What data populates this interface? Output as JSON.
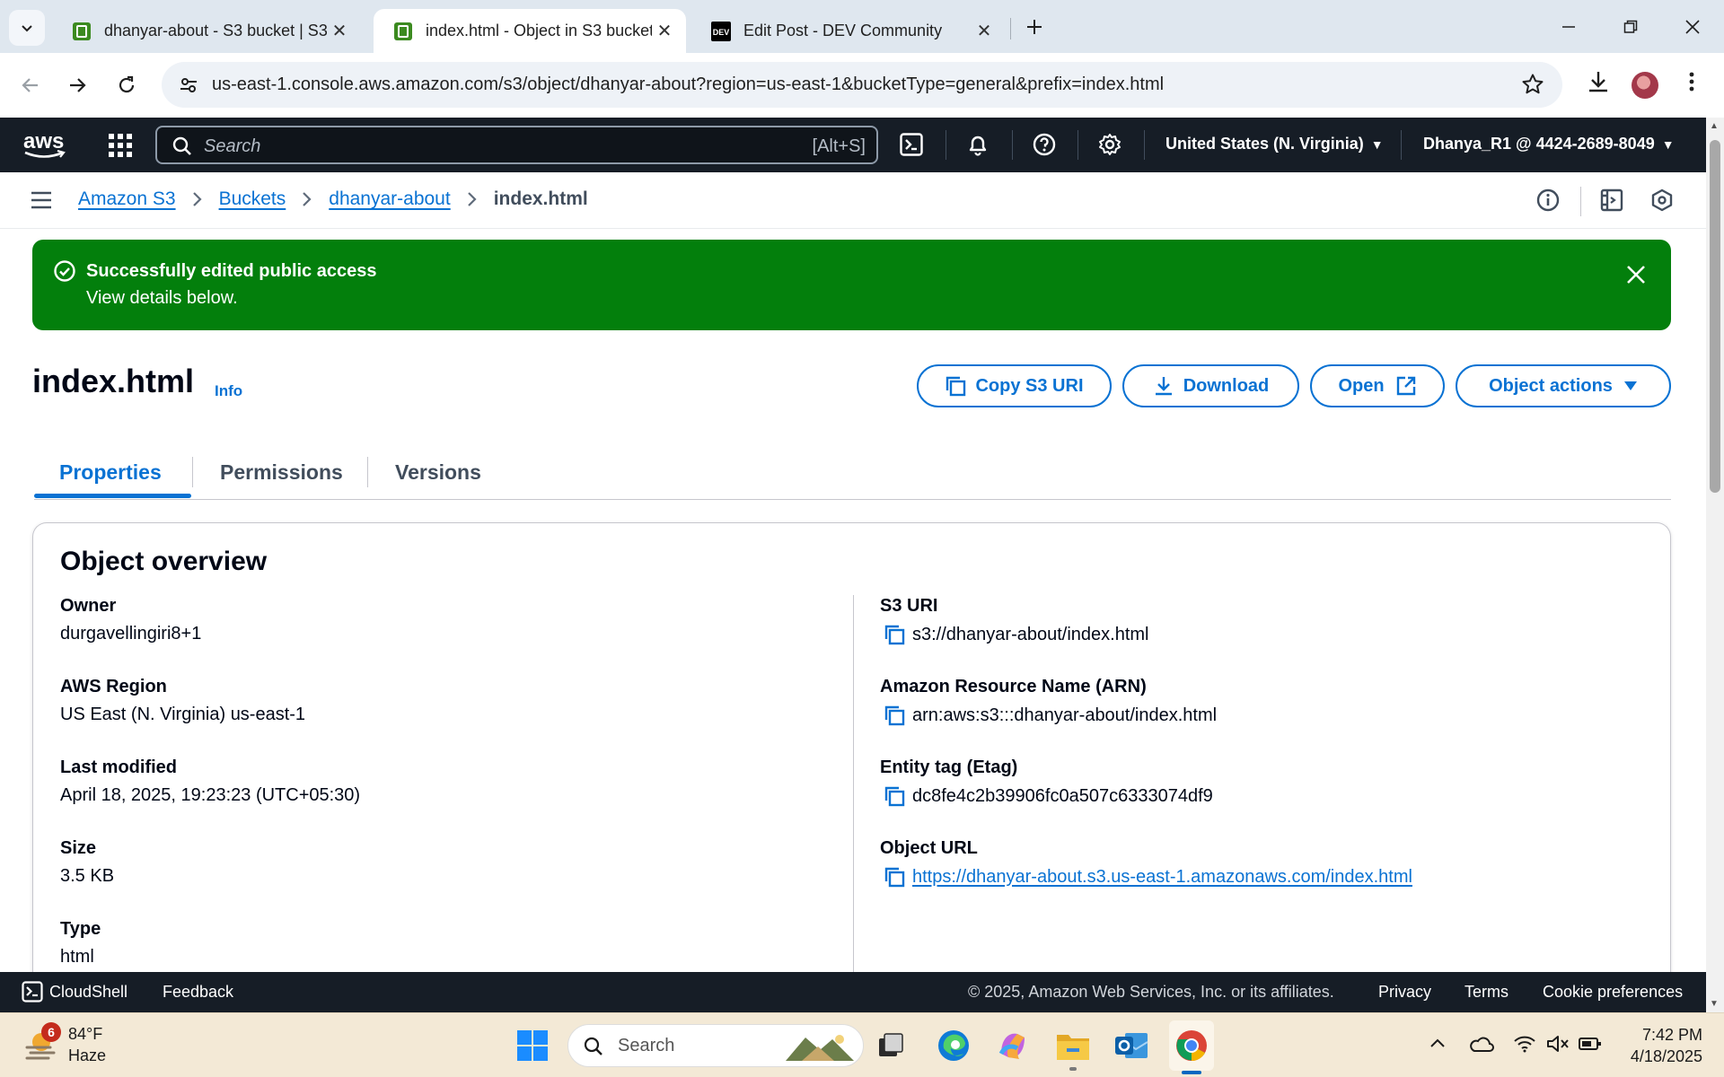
{
  "browser": {
    "tabs": [
      {
        "title": "dhanyar-about - S3 bucket | S3",
        "active": false
      },
      {
        "title": "index.html - Object in S3 bucket",
        "active": true
      },
      {
        "title": "Edit Post - DEV Community",
        "active": false
      }
    ],
    "url": "us-east-1.console.aws.amazon.com/s3/object/dhanyar-about?region=us-east-1&bucketType=general&prefix=index.html"
  },
  "aws_nav": {
    "search_placeholder": "Search",
    "search_shortcut": "[Alt+S]",
    "region": "United States (N. Virginia)",
    "account": "Dhanya_R1 @ 4424-2689-8049"
  },
  "breadcrumb": {
    "items": [
      "Amazon S3",
      "Buckets",
      "dhanyar-about"
    ],
    "current": "index.html"
  },
  "flash": {
    "title": "Successfully edited public access",
    "message": "View details below."
  },
  "header": {
    "title": "index.html",
    "info": "Info",
    "buttons": {
      "copy_uri": "Copy S3 URI",
      "download": "Download",
      "open": "Open",
      "object_actions": "Object actions"
    }
  },
  "content_tabs": [
    "Properties",
    "Permissions",
    "Versions"
  ],
  "overview": {
    "heading": "Object overview",
    "left": [
      {
        "label": "Owner",
        "value": "durgavellingiri8+1"
      },
      {
        "label": "AWS Region",
        "value": "US East (N. Virginia) us-east-1"
      },
      {
        "label": "Last modified",
        "value": "April 18, 2025, 19:23:23 (UTC+05:30)"
      },
      {
        "label": "Size",
        "value": "3.5 KB"
      },
      {
        "label": "Type",
        "value": "html"
      }
    ],
    "right": [
      {
        "label": "S3 URI",
        "value": "s3://dhanyar-about/index.html"
      },
      {
        "label": "Amazon Resource Name (ARN)",
        "value": "arn:aws:s3:::dhanyar-about/index.html"
      },
      {
        "label": "Entity tag (Etag)",
        "value": "dc8fe4c2b39906fc0a507c6333074df9"
      },
      {
        "label": "Object URL",
        "value": "https://dhanyar-about.s3.us-east-1.amazonaws.com/index.html"
      }
    ]
  },
  "footer": {
    "cloudshell": "CloudShell",
    "feedback": "Feedback",
    "copyright": "© 2025, Amazon Web Services, Inc. or its affiliates.",
    "privacy": "Privacy",
    "terms": "Terms",
    "cookies": "Cookie preferences"
  },
  "taskbar": {
    "weather_temp": "84°F",
    "weather_desc": "Haze",
    "weather_badge": "6",
    "search": "Search",
    "time": "7:42 PM",
    "date": "4/18/2025"
  },
  "colors": {
    "aws_nav_bg": "#161d26",
    "link_blue": "#0972d3",
    "success_green": "#037f0c"
  }
}
